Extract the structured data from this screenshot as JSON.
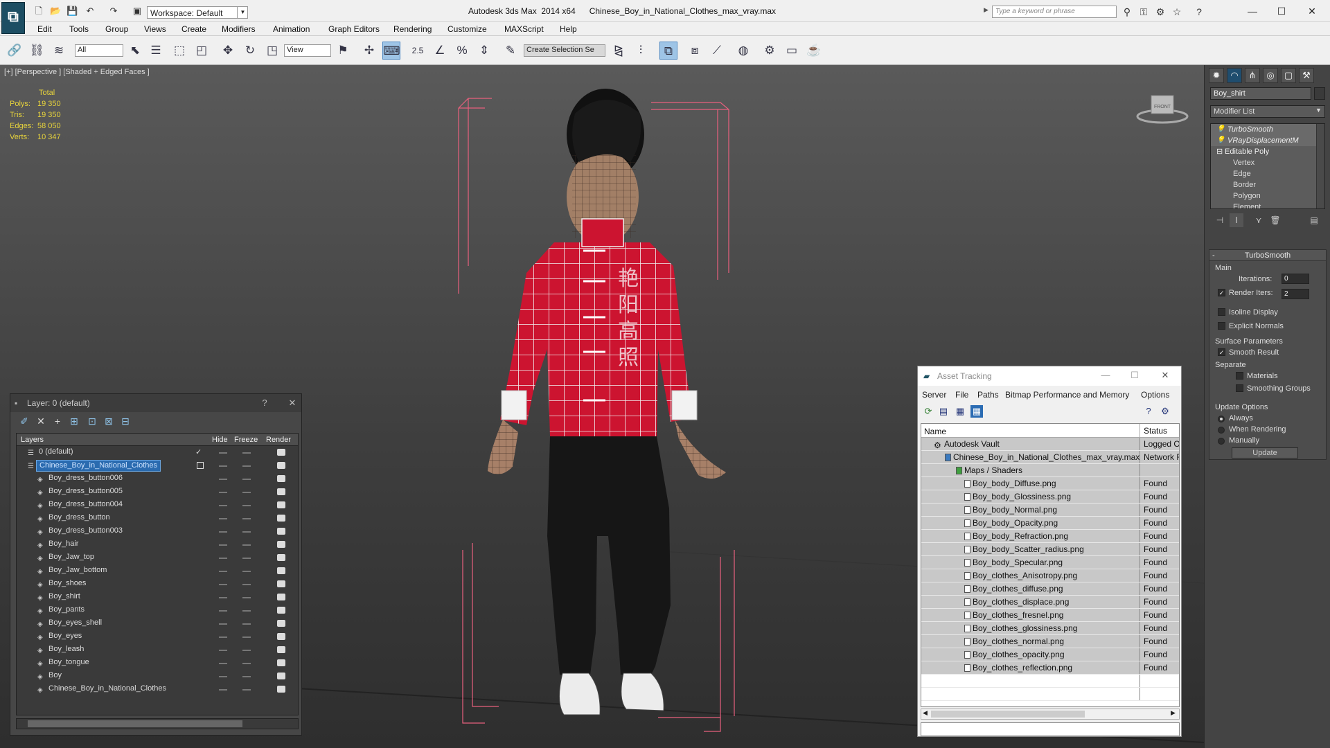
{
  "titlebar": {
    "workspace": "Workspace: Default",
    "app_title": "Autodesk 3ds Max  2014 x64      Chinese_Boy_in_National_Clothes_max_vray.max",
    "search_placeholder": "Type a keyword or phrase"
  },
  "menu": [
    "Edit",
    "Tools",
    "Group",
    "Views",
    "Create",
    "Modifiers",
    "Animation",
    "Graph Editors",
    "Rendering",
    "Customize",
    "MAXScript",
    "Help"
  ],
  "toolbar": {
    "filter": "All",
    "ref_coord": "View",
    "snap_value": "2.5",
    "selection_set": "Create Selection Se"
  },
  "viewport": {
    "label": "[+] [Perspective ] [Shaded + Edged Faces ]",
    "cube_label": "FRONT",
    "stats": {
      "header": "Total",
      "rows": [
        {
          "label": "Polys:",
          "value": "19 350"
        },
        {
          "label": "Tris:",
          "value": "19 350"
        },
        {
          "label": "Edges:",
          "value": "58 050"
        },
        {
          "label": "Verts:",
          "value": "10 347"
        }
      ]
    },
    "shirt_text": [
      "艳",
      "阳",
      "高",
      "照"
    ]
  },
  "command_panel": {
    "object_name": "Boy_shirt",
    "modifier_list": "Modifier List",
    "stack": [
      {
        "label": "TurboSmooth",
        "kind": "mod"
      },
      {
        "label": "VRayDisplacementM",
        "kind": "mod"
      },
      {
        "label": "Editable Poly",
        "kind": "base"
      },
      {
        "label": "Vertex",
        "kind": "sub"
      },
      {
        "label": "Edge",
        "kind": "sub"
      },
      {
        "label": "Border",
        "kind": "sub"
      },
      {
        "label": "Polygon",
        "kind": "sub"
      },
      {
        "label": "Element",
        "kind": "sub"
      }
    ],
    "turbosmooth": {
      "title": "TurboSmooth",
      "main": "Main",
      "iterations_label": "Iterations:",
      "iterations": "0",
      "render_iters_label": "Render Iters:",
      "render_iters": "2",
      "isoline": "Isoline Display",
      "explicit": "Explicit Normals",
      "surface": "Surface Parameters",
      "smooth_result": "Smooth Result",
      "separate": "Separate",
      "materials": "Materials",
      "smoothing_groups": "Smoothing Groups",
      "update_options": "Update Options",
      "always": "Always",
      "when_rendering": "When Rendering",
      "manually": "Manually",
      "update": "Update"
    }
  },
  "layer_window": {
    "title": "Layer: 0 (default)",
    "help": "?",
    "close": "✕",
    "columns": {
      "layers": "Layers",
      "hide": "Hide",
      "freeze": "Freeze",
      "render": "Render"
    },
    "rows": [
      {
        "name": "0 (default)",
        "level": 0,
        "selected": false,
        "check": "✓"
      },
      {
        "name": "Chinese_Boy_in_National_Clothes",
        "level": 0,
        "selected": true,
        "check": ""
      },
      {
        "name": "Boy_dress_button006",
        "level": 1,
        "selected": false,
        "check": ""
      },
      {
        "name": "Boy_dress_button005",
        "level": 1,
        "selected": false,
        "check": ""
      },
      {
        "name": "Boy_dress_button004",
        "level": 1,
        "selected": false,
        "check": ""
      },
      {
        "name": "Boy_dress_button",
        "level": 1,
        "selected": false,
        "check": ""
      },
      {
        "name": "Boy_dress_button003",
        "level": 1,
        "selected": false,
        "check": ""
      },
      {
        "name": "Boy_hair",
        "level": 1,
        "selected": false,
        "check": ""
      },
      {
        "name": "Boy_Jaw_top",
        "level": 1,
        "selected": false,
        "check": ""
      },
      {
        "name": "Boy_Jaw_bottom",
        "level": 1,
        "selected": false,
        "check": ""
      },
      {
        "name": "Boy_shoes",
        "level": 1,
        "selected": false,
        "check": ""
      },
      {
        "name": "Boy_shirt",
        "level": 1,
        "selected": false,
        "check": ""
      },
      {
        "name": "Boy_pants",
        "level": 1,
        "selected": false,
        "check": ""
      },
      {
        "name": "Boy_eyes_shell",
        "level": 1,
        "selected": false,
        "check": ""
      },
      {
        "name": "Boy_eyes",
        "level": 1,
        "selected": false,
        "check": ""
      },
      {
        "name": "Boy_leash",
        "level": 1,
        "selected": false,
        "check": ""
      },
      {
        "name": "Boy_tongue",
        "level": 1,
        "selected": false,
        "check": ""
      },
      {
        "name": "Boy",
        "level": 1,
        "selected": false,
        "check": ""
      },
      {
        "name": "Chinese_Boy_in_National_Clothes",
        "level": 1,
        "selected": false,
        "check": ""
      }
    ]
  },
  "asset_window": {
    "title": "Asset Tracking",
    "menu": [
      "Server",
      "File",
      "Paths",
      "Bitmap Performance and Memory",
      "Options"
    ],
    "columns": {
      "name": "Name",
      "status": "Status"
    },
    "rows": [
      {
        "name": "Autodesk Vault",
        "status": "Logged O",
        "level": 0
      },
      {
        "name": "Chinese_Boy_in_National_Clothes_max_vray.max",
        "status": "Network F",
        "level": 1
      },
      {
        "name": "Maps / Shaders",
        "status": "",
        "level": 2
      },
      {
        "name": "Boy_body_Diffuse.png",
        "status": "Found",
        "level": 3
      },
      {
        "name": "Boy_body_Glossiness.png",
        "status": "Found",
        "level": 3
      },
      {
        "name": "Boy_body_Normal.png",
        "status": "Found",
        "level": 3
      },
      {
        "name": "Boy_body_Opacity.png",
        "status": "Found",
        "level": 3
      },
      {
        "name": "Boy_body_Refraction.png",
        "status": "Found",
        "level": 3
      },
      {
        "name": "Boy_body_Scatter_radius.png",
        "status": "Found",
        "level": 3
      },
      {
        "name": "Boy_body_Specular.png",
        "status": "Found",
        "level": 3
      },
      {
        "name": "Boy_clothes_Anisotropy.png",
        "status": "Found",
        "level": 3
      },
      {
        "name": "Boy_clothes_diffuse.png",
        "status": "Found",
        "level": 3
      },
      {
        "name": "Boy_clothes_displace.png",
        "status": "Found",
        "level": 3
      },
      {
        "name": "Boy_clothes_fresnel.png",
        "status": "Found",
        "level": 3
      },
      {
        "name": "Boy_clothes_glossiness.png",
        "status": "Found",
        "level": 3
      },
      {
        "name": "Boy_clothes_normal.png",
        "status": "Found",
        "level": 3
      },
      {
        "name": "Boy_clothes_opacity.png",
        "status": "Found",
        "level": 3
      },
      {
        "name": "Boy_clothes_reflection.png",
        "status": "Found",
        "level": 3
      }
    ]
  }
}
